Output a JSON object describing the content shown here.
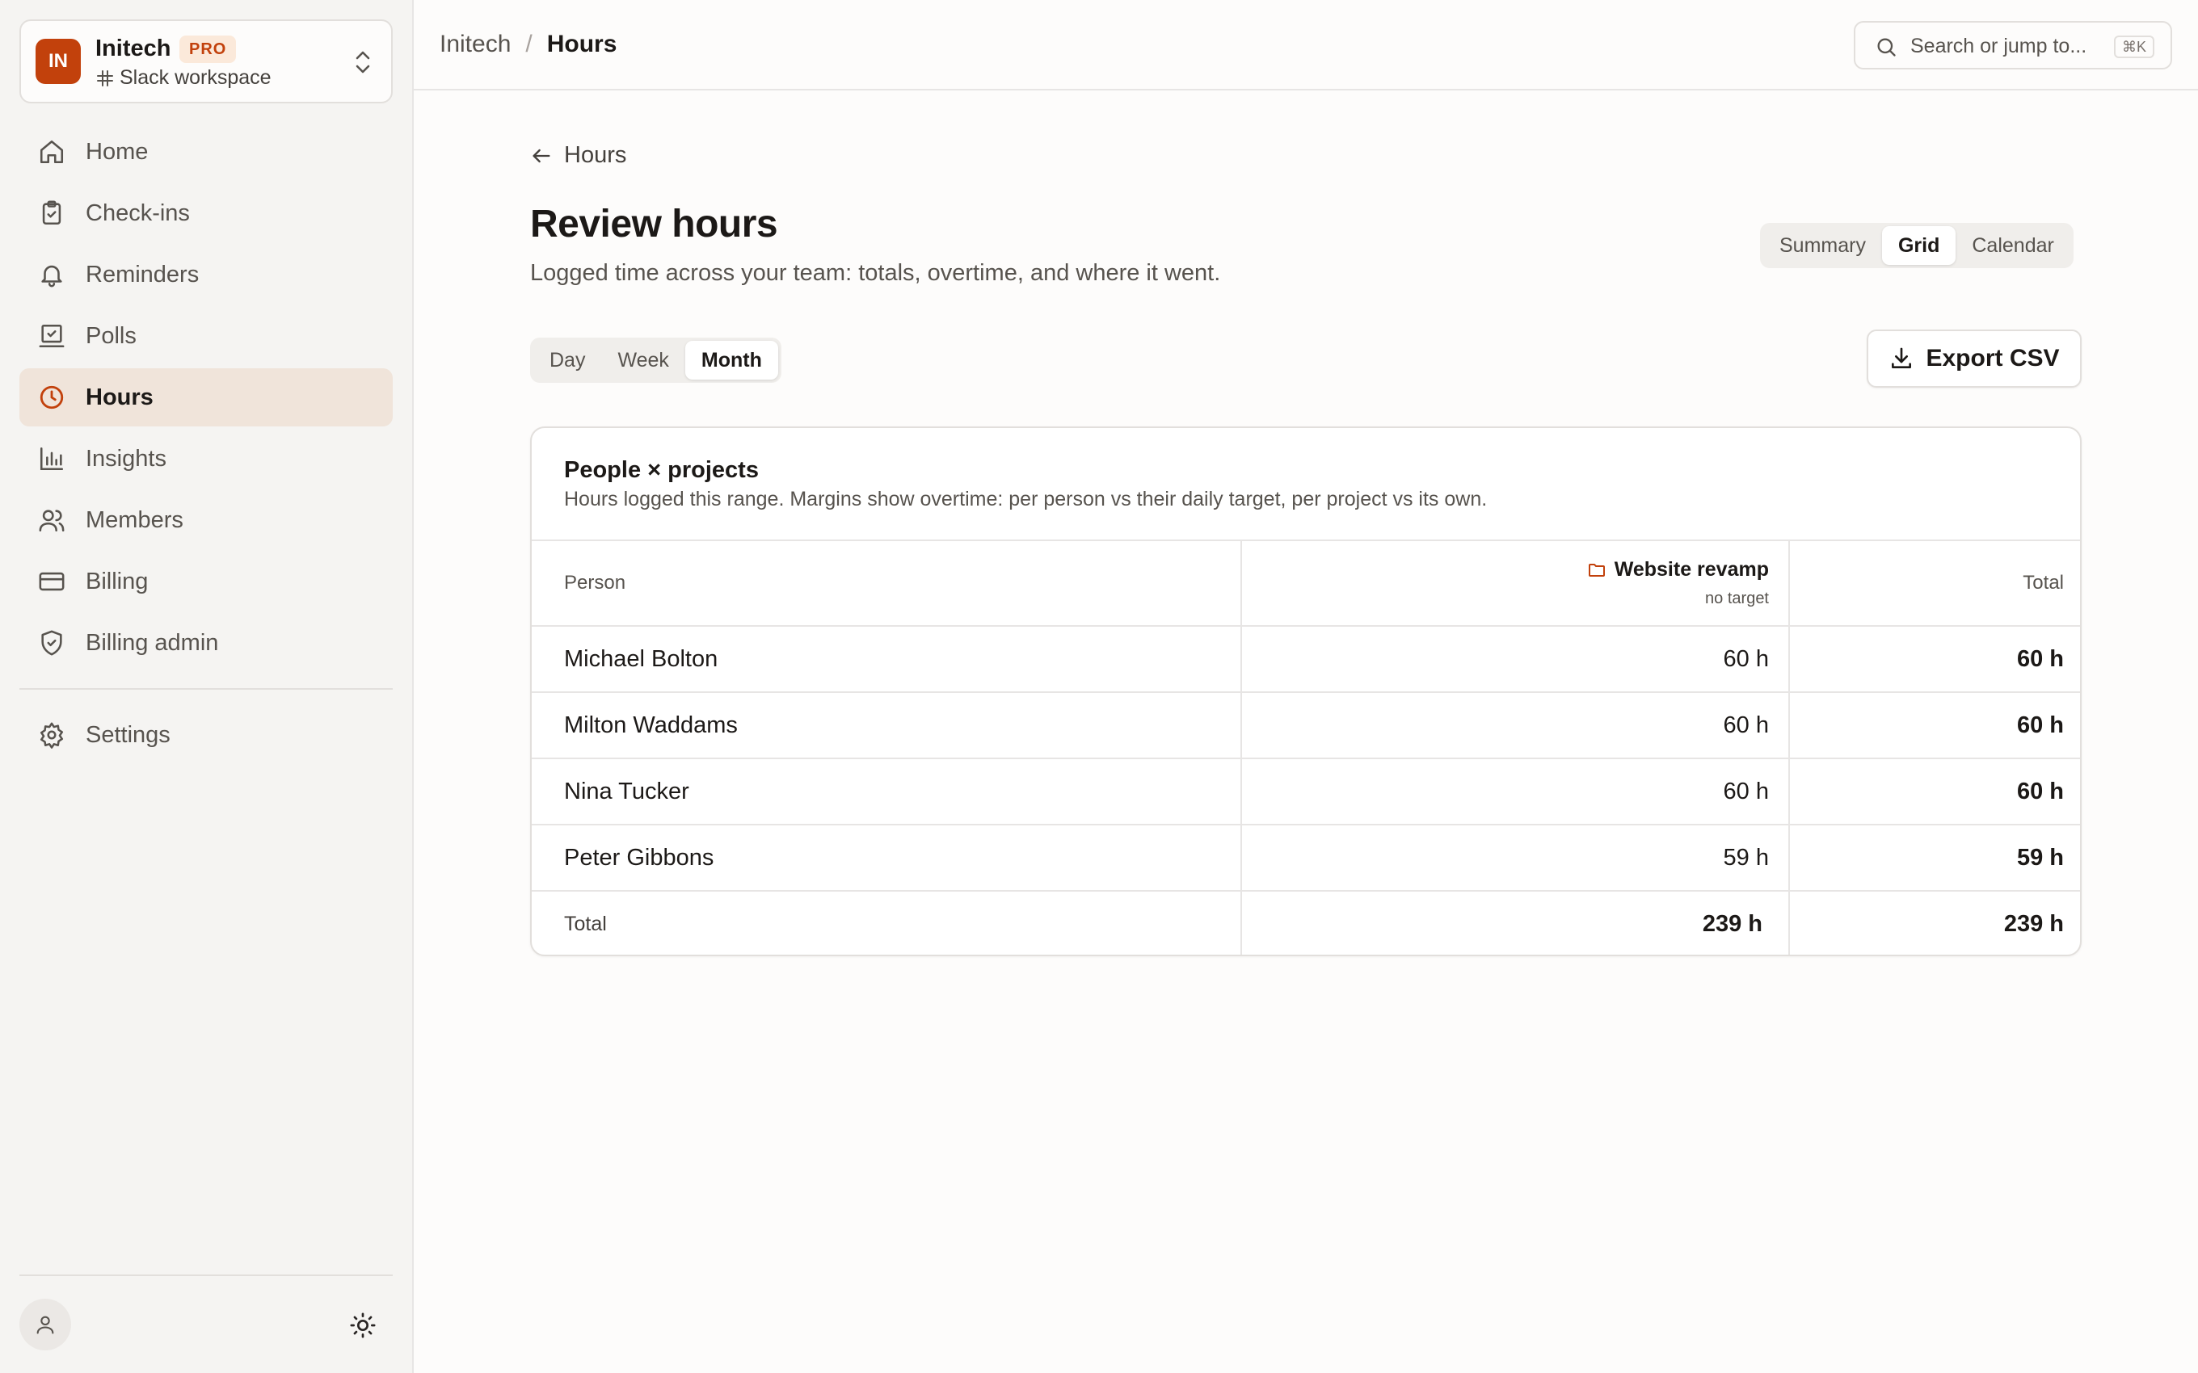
{
  "workspace": {
    "initials": "IN",
    "name": "Initech",
    "plan_badge": "PRO",
    "subtitle": "Slack workspace"
  },
  "sidebar": {
    "items": [
      {
        "label": "Home",
        "icon": "home-icon"
      },
      {
        "label": "Check-ins",
        "icon": "clipboard-check-icon"
      },
      {
        "label": "Reminders",
        "icon": "bell-icon"
      },
      {
        "label": "Polls",
        "icon": "poll-icon"
      },
      {
        "label": "Hours",
        "icon": "clock-icon",
        "active": true
      },
      {
        "label": "Insights",
        "icon": "bar-chart-icon"
      },
      {
        "label": "Members",
        "icon": "users-icon"
      },
      {
        "label": "Billing",
        "icon": "credit-card-icon"
      },
      {
        "label": "Billing admin",
        "icon": "shield-check-icon"
      }
    ],
    "settings_label": "Settings"
  },
  "topbar": {
    "breadcrumb": [
      "Initech",
      "Hours"
    ],
    "search_placeholder": "Search or jump to...",
    "search_shortcut": "⌘K"
  },
  "page": {
    "back_label": "Hours",
    "title": "Review hours",
    "subtitle": "Logged time across your team: totals, overtime, and where it went.",
    "view_tabs": [
      "Summary",
      "Grid",
      "Calendar"
    ],
    "view_selected": "Grid",
    "range_tabs": [
      "Day",
      "Week",
      "Month"
    ],
    "range_selected": "Month",
    "export_label": "Export CSV"
  },
  "card": {
    "title": "People × projects",
    "subtitle": "Hours logged this range. Margins show overtime: per person vs their daily target, per project vs its own.",
    "columns": {
      "person": "Person",
      "project": "Website revamp",
      "project_note": "no target",
      "total": "Total"
    },
    "rows": [
      {
        "person": "Michael Bolton",
        "project": "60 h",
        "total": "60 h"
      },
      {
        "person": "Milton Waddams",
        "project": "60 h",
        "total": "60 h"
      },
      {
        "person": "Nina Tucker",
        "project": "60 h",
        "total": "60 h"
      },
      {
        "person": "Peter Gibbons",
        "project": "59 h",
        "total": "59 h"
      }
    ],
    "total_row": {
      "label": "Total",
      "project": "239 h",
      "total": "239 h"
    }
  },
  "colors": {
    "accent": "#c2410c",
    "active_nav_bg": "#f0e4da"
  }
}
